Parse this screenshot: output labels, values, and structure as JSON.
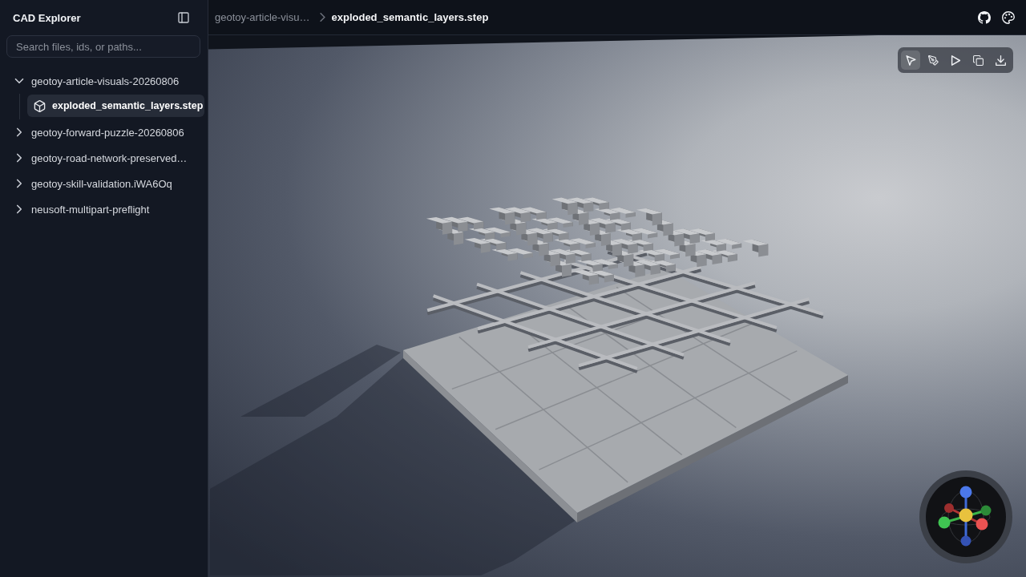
{
  "sidebar": {
    "title": "CAD Explorer",
    "search": {
      "placeholder": "Search files, ids, or paths..."
    },
    "tree": [
      {
        "label": "geotoy-article-visuals-20260806",
        "expanded": true,
        "selected": false,
        "children": [
          {
            "label": "exploded_semantic_layers.step",
            "selected": true
          }
        ]
      },
      {
        "label": "geotoy-forward-puzzle-20260806",
        "expanded": false,
        "selected": false
      },
      {
        "label": "geotoy-road-network-preserved…",
        "expanded": false,
        "selected": false
      },
      {
        "label": "geotoy-skill-validation.iWA6Oq",
        "expanded": false,
        "selected": false
      },
      {
        "label": "neusoft-multipart-preflight",
        "expanded": false,
        "selected": false
      }
    ]
  },
  "header": {
    "breadcrumb": [
      {
        "label": "geotoy-article-visu…",
        "current": false
      },
      {
        "label": "exploded_semantic_layers.step",
        "current": true
      }
    ]
  },
  "viewer": {
    "toolbar": [
      {
        "kind": "select",
        "selected": true
      },
      {
        "kind": "pen",
        "selected": false
      },
      {
        "kind": "play",
        "selected": false
      },
      {
        "kind": "copy",
        "selected": false
      },
      {
        "kind": "download",
        "selected": false
      }
    ]
  }
}
